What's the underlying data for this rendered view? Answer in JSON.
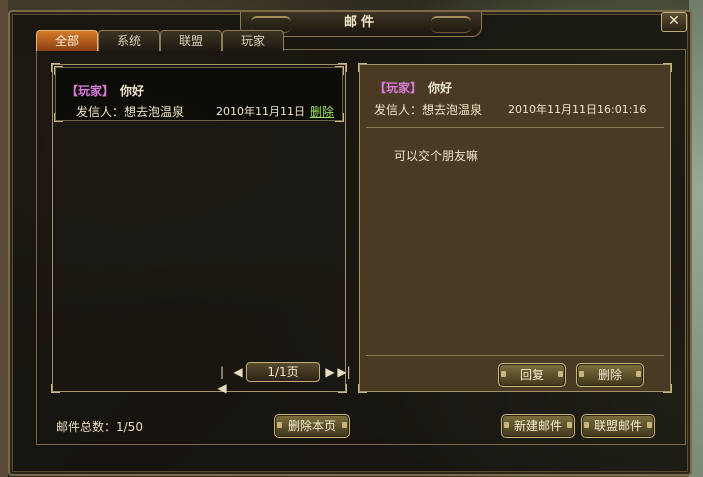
{
  "window": {
    "title": "邮件",
    "close_label": "✕"
  },
  "tabs": [
    {
      "label": "全部",
      "active": true
    },
    {
      "label": "系统",
      "active": false
    },
    {
      "label": "联盟",
      "active": false
    },
    {
      "label": "玩家",
      "active": false
    }
  ],
  "mail_list": [
    {
      "tag": "【玩家】",
      "subject": "你好",
      "sender_label": "发信人：想去泡温泉",
      "date": "2010年11月11日",
      "delete_label": "删除"
    }
  ],
  "pager": {
    "first": "|◀",
    "prev": "◀",
    "page": "1/1页",
    "next": "▶",
    "last": "▶|"
  },
  "detail": {
    "tag": "【玩家】",
    "subject": "你好",
    "sender_label": "发信人：想去泡温泉",
    "datetime": "2010年11月11日16:01:16",
    "body": "可以交个朋友嘛",
    "reply_label": "回复",
    "delete_label": "删除"
  },
  "footer": {
    "total": "邮件总数：1/50",
    "delete_page_label": "删除本页",
    "new_mail_label": "新建邮件",
    "alliance_mail_label": "联盟邮件"
  },
  "colors": {
    "accent_tab": "#d87a2a",
    "tag_color": "#d57bd8",
    "link_green": "#9ae05a",
    "detail_bg": "#4a3a24"
  }
}
